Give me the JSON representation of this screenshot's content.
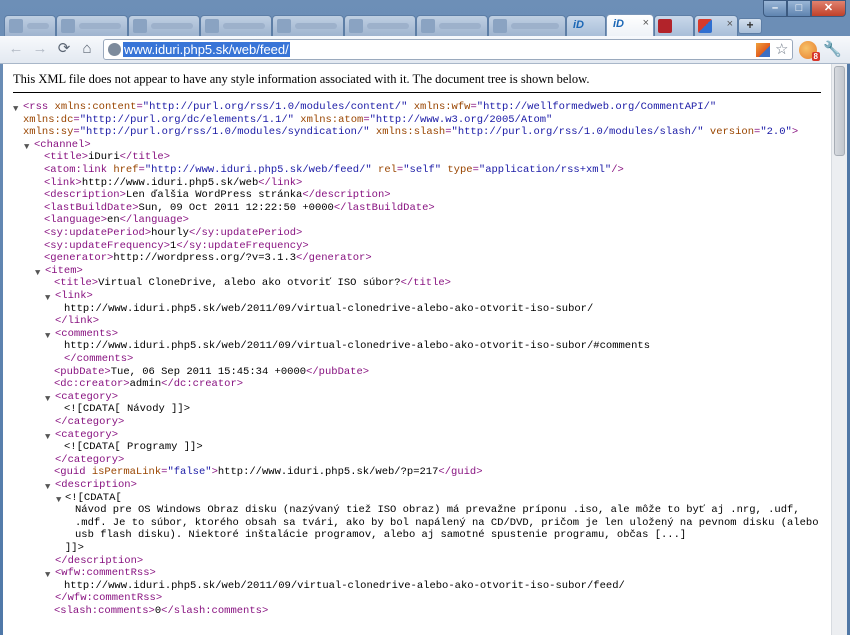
{
  "browser": {
    "tabs": [
      {
        "title": "",
        "state": "blurred"
      },
      {
        "title": "",
        "state": "blurred"
      },
      {
        "title": "",
        "state": "blurred"
      },
      {
        "title": "",
        "state": "blurred"
      },
      {
        "title": "",
        "state": "blurred"
      },
      {
        "title": "",
        "state": "blurred"
      },
      {
        "title": "",
        "state": "blurred"
      },
      {
        "title": "",
        "state": "blurred"
      },
      {
        "title": "iD",
        "state": "normal",
        "icon": "iduri-favicon"
      },
      {
        "title": "iD ",
        "state": "active",
        "icon": "iduri-favicon"
      },
      {
        "title": "",
        "state": "normal",
        "icon": "flash-favicon"
      },
      {
        "title": "",
        "state": "normal",
        "icon": "web-favicon"
      }
    ],
    "active_tab_close": "×",
    "tab_close": "×",
    "new_tab_label": "+",
    "window_controls": {
      "minimize": "–",
      "maximize": "□",
      "close": "✕"
    },
    "url": "www.iduri.php5.sk/web/feed/",
    "icons": [
      "back-icon",
      "forward-icon",
      "reload-icon",
      "home-icon",
      "globe-icon",
      "rss-icon",
      "star-icon",
      "extension-icon",
      "wrench-icon"
    ],
    "extension_badge": "8"
  },
  "page": {
    "notice": "This XML file does not appear to have any style information associated with it. The document tree is shown below."
  },
  "xml": {
    "rss": {
      "open": "<rss",
      "attrs1": [
        {
          "n": "xmlns:content",
          "v": "\"http://purl.org/rss/1.0/modules/content/\""
        },
        {
          "n": "xmlns:wfw",
          "v": "\"http://wellformedweb.org/CommentAPI/\""
        }
      ],
      "attrs2": [
        {
          "n": "xmlns:dc",
          "v": "\"http://purl.org/dc/elements/1.1/\""
        },
        {
          "n": "xmlns:atom",
          "v": "\"http://www.w3.org/2005/Atom\""
        }
      ],
      "attrs3": [
        {
          "n": "xmlns:sy",
          "v": "\"http://purl.org/rss/1.0/modules/syndication/\""
        },
        {
          "n": "xmlns:slash",
          "v": "\"http://purl.org/rss/1.0/modules/slash/\""
        },
        {
          "n": "version",
          "v": "\"2.0\""
        }
      ]
    },
    "channel": "<channel>",
    "title": {
      "o": "<title>",
      "t": "iDuri",
      "c": "</title>"
    },
    "atom": {
      "o": "<atom:link",
      "n1": "href",
      "v1": "\"http://www.iduri.php5.sk/web/feed/\"",
      "n2": "rel",
      "v2": "\"self\"",
      "n3": "type",
      "v3": "\"application/rss+xml\"",
      "c": "/>"
    },
    "link": {
      "o": "<link>",
      "t": "http://www.iduri.php5.sk/web",
      "c": "</link>"
    },
    "description": {
      "o": "<description>",
      "t": "Len ďalšia WordPress stránka",
      "c": "</description>"
    },
    "lastBuildDate": {
      "o": "<lastBuildDate>",
      "t": "Sun, 09 Oct 2011 12:22:50 +0000",
      "c": "</lastBuildDate>"
    },
    "language": {
      "o": "<language>",
      "t": "en",
      "c": "</language>"
    },
    "updatePeriod": {
      "o": "<sy:updatePeriod>",
      "t": "hourly",
      "c": "</sy:updatePeriod>"
    },
    "updateFrequency": {
      "o": "<sy:updateFrequency>",
      "t": "1",
      "c": "</sy:updateFrequency>"
    },
    "generator": {
      "o": "<generator>",
      "t": "http://wordpress.org/?v=3.1.3",
      "c": "</generator>"
    },
    "item": {
      "open": "<item>",
      "title": {
        "o": "<title>",
        "t": "Virtual CloneDrive, alebo ako otvoriť ISO súbor?",
        "c": "</title>"
      },
      "link_open": "<link>",
      "link_text": "http://www.iduri.php5.sk/web/2011/09/virtual-clonedrive-alebo-ako-otvorit-iso-subor/",
      "link_close": "</link>",
      "comments_open": "<comments>",
      "comments_text": "http://www.iduri.php5.sk/web/2011/09/virtual-clonedrive-alebo-ako-otvorit-iso-subor/#comments",
      "comments_close": "</comments>",
      "pubDate": {
        "o": "<pubDate>",
        "t": "Tue, 06 Sep 2011 15:45:34 +0000",
        "c": "</pubDate>"
      },
      "creator": {
        "o": "<dc:creator>",
        "t": "admin",
        "c": "</dc:creator>"
      },
      "category1_open": "<category>",
      "category1_text": "<![CDATA[ Návody ]]>",
      "category1_close": "</category>",
      "category2_open": "<category>",
      "category2_text": "<![CDATA[ Programy ]]>",
      "category2_close": "</category>",
      "guid": {
        "o": "<guid",
        "n": "isPermaLink",
        "v": "\"false\"",
        "gt": ">",
        "t": "http://www.iduri.php5.sk/web/?p=217",
        "c": "</guid>"
      },
      "desc_open": "<description>",
      "cdata_open": "<![CDATA[",
      "cdata_lines": [
        "Návod pre OS Windows Obraz disku (nazývaný tiež ISO obraz) má prevažne príponu .iso, ale môže to byť aj .nrg, .udf,",
        ".mdf. Je to súbor, ktorého obsah sa tvári, ako by bol napálený na CD/DVD, pričom je len uložený na pevnom disku (alebo",
        "usb flash disku). Niektoré inštalácie programov, alebo aj samotné spustenie programu, občas [...]"
      ],
      "cdata_close": "]]>",
      "desc_close": "</description>",
      "commentRss_open": "<wfw:commentRss>",
      "commentRss_text": "http://www.iduri.php5.sk/web/2011/09/virtual-clonedrive-alebo-ako-otvorit-iso-subor/feed/",
      "commentRss_close": "</wfw:commentRss>",
      "slash": {
        "o": "<slash:comments>",
        "t": "0",
        "c": "</slash:comments>"
      }
    },
    "toggle": "▼"
  },
  "colors": {
    "tag": "#881280",
    "attr_name": "#994500",
    "attr_value": "#1a1aa6",
    "selection": "#3875d7",
    "frame": "#5f84b0"
  }
}
